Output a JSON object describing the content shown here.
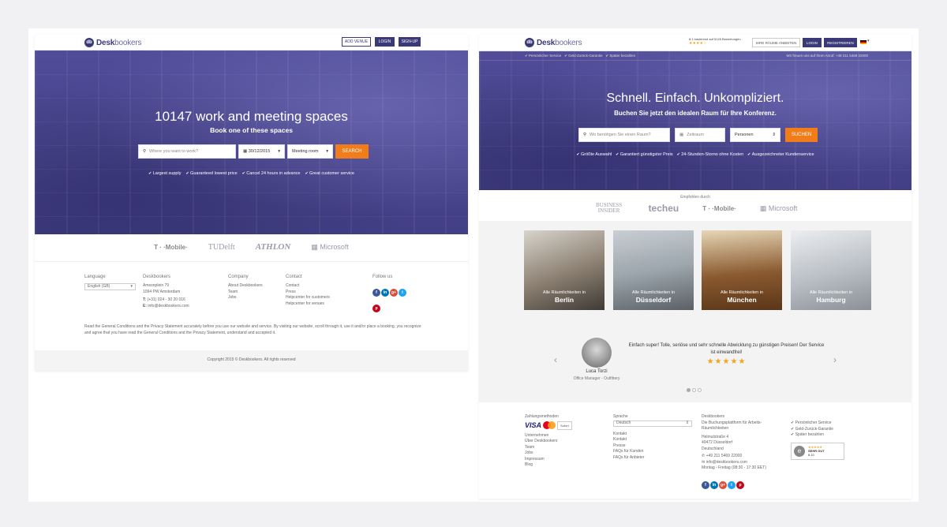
{
  "left": {
    "logo": {
      "mark": "db",
      "brand": "Desk",
      "brand2": "bookers"
    },
    "nav": {
      "add_venue": "ADD VENUE",
      "login": "LOGIN",
      "signup": "SIGN-UP"
    },
    "hero": {
      "title": "10147 work and meeting spaces",
      "subtitle": "Book one of these spaces",
      "search_placeholder": "Where you want to work?",
      "date": "30/12/2015",
      "type": "Meeting room",
      "search_btn": "SEARCH"
    },
    "usps": [
      "Largest supply",
      "Guaranteed lowest price",
      "Cancel 24 hours in advance",
      "Great customer service"
    ],
    "logos": [
      "T · ·Mobile·",
      "TUDelft",
      "ATHLON",
      "Microsoft"
    ],
    "footer": {
      "language_label": "Language",
      "language_value": "English (GB)",
      "company_name": "Deskbookers",
      "address1": "Amsonplein 79",
      "address2": "1094 PW Amsterdam",
      "phone": "(+31) 024 - 30 20 016",
      "email": "info@deskbookers.com",
      "company_label": "Company",
      "company_links": [
        "About Deskbookers",
        "Team",
        "Jobs"
      ],
      "contact_label": "Contact",
      "contact_links": [
        "Contact",
        "Press",
        "Helpcenter for customers",
        "Helpcenter for venues"
      ],
      "follow_label": "Follow us",
      "legal": "Read the General Conditions and the Privacy Statement accurately before you use our website and service. By visiting our website, scroll through it, use it and/or place a booking, you recognize and agree that you have read the General Conditions and the Privacy Statement, understand and accepted it.",
      "copyright": "Copyright 2015 © Deskbookers. All rights reserved"
    }
  },
  "right": {
    "logo": {
      "mark": "db",
      "brand": "Desk",
      "brand2": "bookers"
    },
    "rating": "8,1 basierend auf 5145 Bewertungen",
    "nav": {
      "offer": "IHRE RÄUME ANBIETEN",
      "login": "LOGIN",
      "register": "REGISTRIEREN"
    },
    "topbar": {
      "usps": [
        "Persönlicher Service",
        "Geld-Zurück-Garantie",
        "Später bezahlen"
      ],
      "call": "Wir freuen uns auf Ihren Anruf: +49 211 5469 22000"
    },
    "hero": {
      "title": "Schnell. Einfach. Unkompliziert.",
      "subtitle": "Buchen Sie jetzt den idealen Raum für Ihre Konferenz.",
      "search_placeholder": "Wo benötigen Sie einen Raum?",
      "date": "Zeitraum",
      "persons": "Personen",
      "search_btn": "SUCHEN"
    },
    "usps": [
      "Größte Auswahl",
      "Garantiert günstigster Preis",
      "24-Stunden-Storno ohne Kosten",
      "Ausgezeichneter Kundenservice"
    ],
    "recommended": "Empfohlen durch",
    "logos": [
      "BUSINESS INSIDER",
      "techeu",
      "T · ·Mobile·",
      "Microsoft"
    ],
    "cities": [
      {
        "pre": "Alle Räumlichkeiten in",
        "name": "Berlin"
      },
      {
        "pre": "Alle Räumlichkeiten in",
        "name": "Düsseldorf"
      },
      {
        "pre": "Alle Räumlichkeiten in",
        "name": "München"
      },
      {
        "pre": "Alle Räumlichkeiten in",
        "name": "Hamburg"
      }
    ],
    "testimonial": {
      "quote": "Einfach super! Tolle, seriöse und sehr schnelle Abwicklung zu günstigen Preisen! Der Service ist einwandfrei!",
      "stars": 5,
      "name": "Luca Torzi",
      "role": "Office Manager - Outfittery"
    },
    "footer": {
      "pay_label": "Zahlungsmethoden",
      "visa": "VISA",
      "sofort": "Sofort",
      "company_label": "Unternehmen",
      "company_links": [
        "Über Deskbookers",
        "Team",
        "Jobs",
        "Impressum",
        "Blog"
      ],
      "lang_label": "Sprache",
      "lang_value": "Deutsch",
      "contact_label": "Kontakt",
      "contact_links": [
        "Kontakt",
        "Presse",
        "FAQs für Kunden",
        "FAQs für Anbieter"
      ],
      "db_label": "Deskbookers",
      "db_desc": "Die Buchungsplattform für Arbeits- Räumlichkeiten",
      "addr1": "Helmutstraße 4",
      "addr2": "40472 Düsseldorf",
      "addr3": "Deutschland",
      "phone": "+49 211 5469 22000",
      "email": "info@deskbookers.com",
      "hours": "Montag - Freitag (08:30 - 17:30 EET)",
      "checks": [
        "Persönlicher Service",
        "Geld-Zurück-Garantie",
        "Später bezahlen"
      ],
      "badge": "SEHR GUT",
      "badge_score": "8.10"
    }
  }
}
